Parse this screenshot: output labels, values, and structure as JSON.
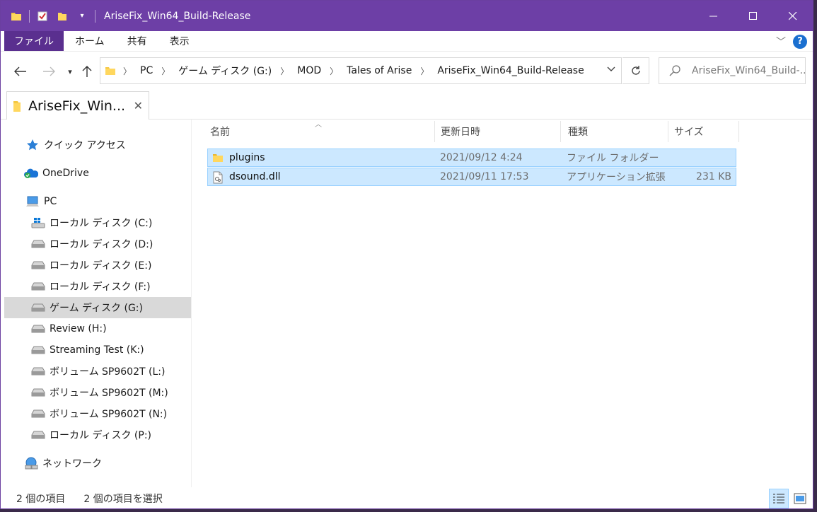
{
  "window": {
    "title": "AriseFix_Win64_Build-Release"
  },
  "ribbon": {
    "tabs": [
      "ファイル",
      "ホーム",
      "共有",
      "表示"
    ]
  },
  "address": {
    "crumbs": [
      "PC",
      "ゲーム ディスク (G:)",
      "MOD",
      "Tales of Arise",
      "AriseFix_Win64_Build-Release"
    ],
    "search_placeholder": "AriseFix_Win64_Build-..."
  },
  "tab": {
    "label": "AriseFix_Win..."
  },
  "sidebar": {
    "items": [
      {
        "label": "クイック アクセス",
        "icon": "star-icon"
      },
      {
        "label": "OneDrive",
        "icon": "onedrive-cloud-icon"
      },
      {
        "label": "PC",
        "icon": "pc-icon"
      },
      {
        "label": "ローカル ディスク (C:)",
        "icon": "windows-drive-icon"
      },
      {
        "label": "ローカル ディスク (D:)",
        "icon": "drive-icon"
      },
      {
        "label": "ローカル ディスク (E:)",
        "icon": "drive-icon"
      },
      {
        "label": "ローカル ディスク (F:)",
        "icon": "drive-icon"
      },
      {
        "label": "ゲーム ディスク (G:)",
        "icon": "drive-icon",
        "selected": true
      },
      {
        "label": "Review (H:)",
        "icon": "drive-icon"
      },
      {
        "label": "Streaming Test (K:)",
        "icon": "drive-icon"
      },
      {
        "label": "ボリューム SP9602T (L:)",
        "icon": "drive-icon"
      },
      {
        "label": "ボリューム SP9602T (M:)",
        "icon": "drive-icon"
      },
      {
        "label": "ボリューム SP9602T (N:)",
        "icon": "drive-icon"
      },
      {
        "label": "ローカル ディスク (P:)",
        "icon": "drive-icon"
      },
      {
        "label": "ネットワーク",
        "icon": "network-icon"
      }
    ]
  },
  "columns": {
    "name": "名前",
    "date": "更新日時",
    "type": "種類",
    "size": "サイズ"
  },
  "files": [
    {
      "name": "plugins",
      "date": "2021/09/12 4:24",
      "type": "ファイル フォルダー",
      "size": "",
      "icon": "folder-icon"
    },
    {
      "name": "dsound.dll",
      "date": "2021/09/11 17:53",
      "type": "アプリケーション拡張",
      "size": "231 KB",
      "icon": "dll-file-icon"
    }
  ],
  "status": {
    "count": "2 個の項目",
    "selected": "2 個の項目を選択"
  },
  "colors": {
    "titlebar": "#6d3fa6",
    "selection": "#cce8ff",
    "selection_border": "#99d1ff"
  }
}
